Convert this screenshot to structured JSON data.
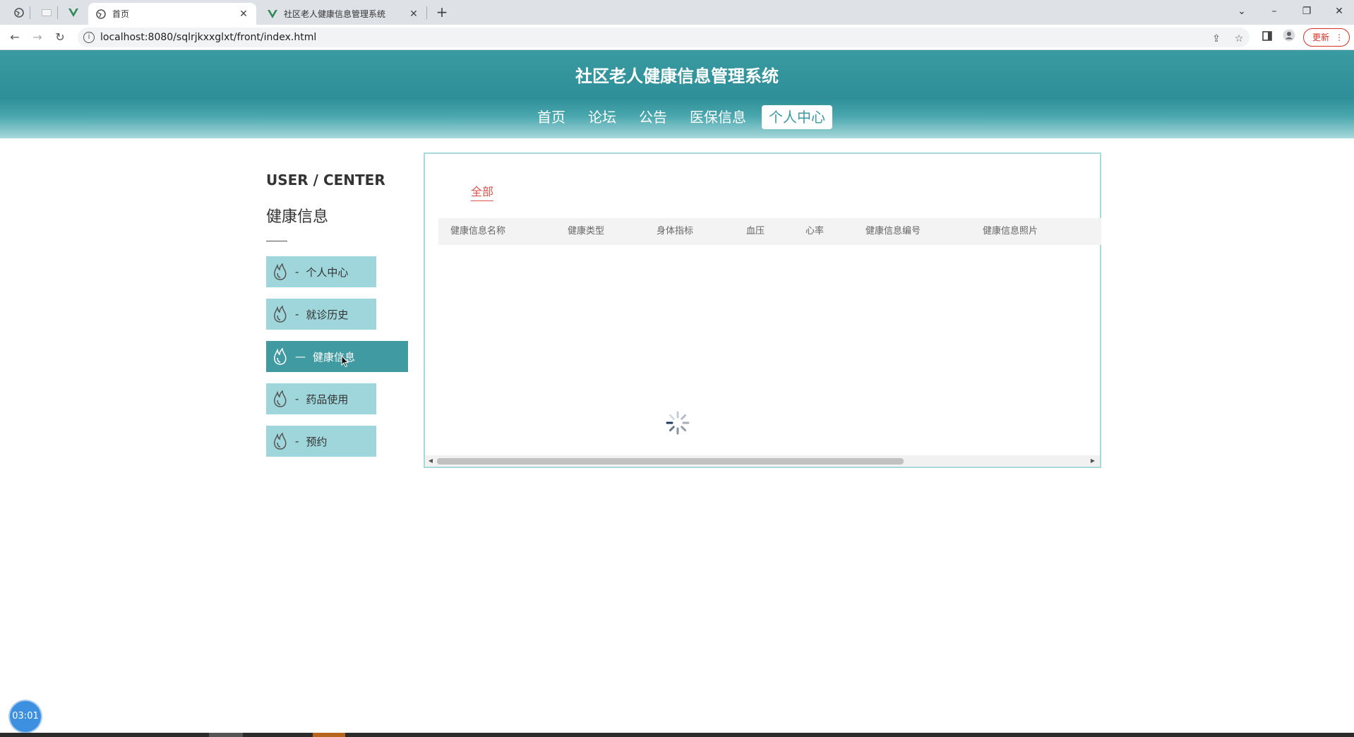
{
  "browser": {
    "tabs": [
      {
        "title": "首页",
        "active": true
      },
      {
        "title": "社区老人健康信息管理系统",
        "active": false
      }
    ],
    "new_tab": "+",
    "url": "localhost:8080/sqlrjkxxglxt/front/index.html",
    "update_label": "更新",
    "window_controls": {
      "minimize": "–",
      "restore": "❐",
      "close": "✕",
      "dropdown": "⌄"
    }
  },
  "header": {
    "title": "社区老人健康信息管理系统",
    "nav": [
      {
        "label": "首页",
        "active": false
      },
      {
        "label": "论坛",
        "active": false
      },
      {
        "label": "公告",
        "active": false
      },
      {
        "label": "医保信息",
        "active": false
      },
      {
        "label": "个人中心",
        "active": true
      }
    ]
  },
  "sidebar": {
    "title": "USER / CENTER",
    "subtitle": "健康信息",
    "items": [
      {
        "label": "个人中心",
        "dash": "-",
        "active": false,
        "icon": "flame-icon"
      },
      {
        "label": "就诊历史",
        "dash": "-",
        "active": false,
        "icon": "flame-icon"
      },
      {
        "label": "健康信息",
        "dash": "—",
        "active": true,
        "icon": "flame-icon"
      },
      {
        "label": "药品使用",
        "dash": "-",
        "active": false,
        "icon": "flame-icon"
      },
      {
        "label": "预约",
        "dash": "-",
        "active": false,
        "icon": "flame-icon"
      }
    ]
  },
  "content": {
    "filter_tab": "全部",
    "columns": [
      "健康信息名称",
      "健康类型",
      "身体指标",
      "血压",
      "心率",
      "健康信息编号",
      "健康信息照片"
    ]
  },
  "timer": {
    "label": "03:01"
  },
  "colors": {
    "teal": "#3a9aa2",
    "light_teal": "#9ed6db",
    "accent_red": "#d9534f"
  }
}
